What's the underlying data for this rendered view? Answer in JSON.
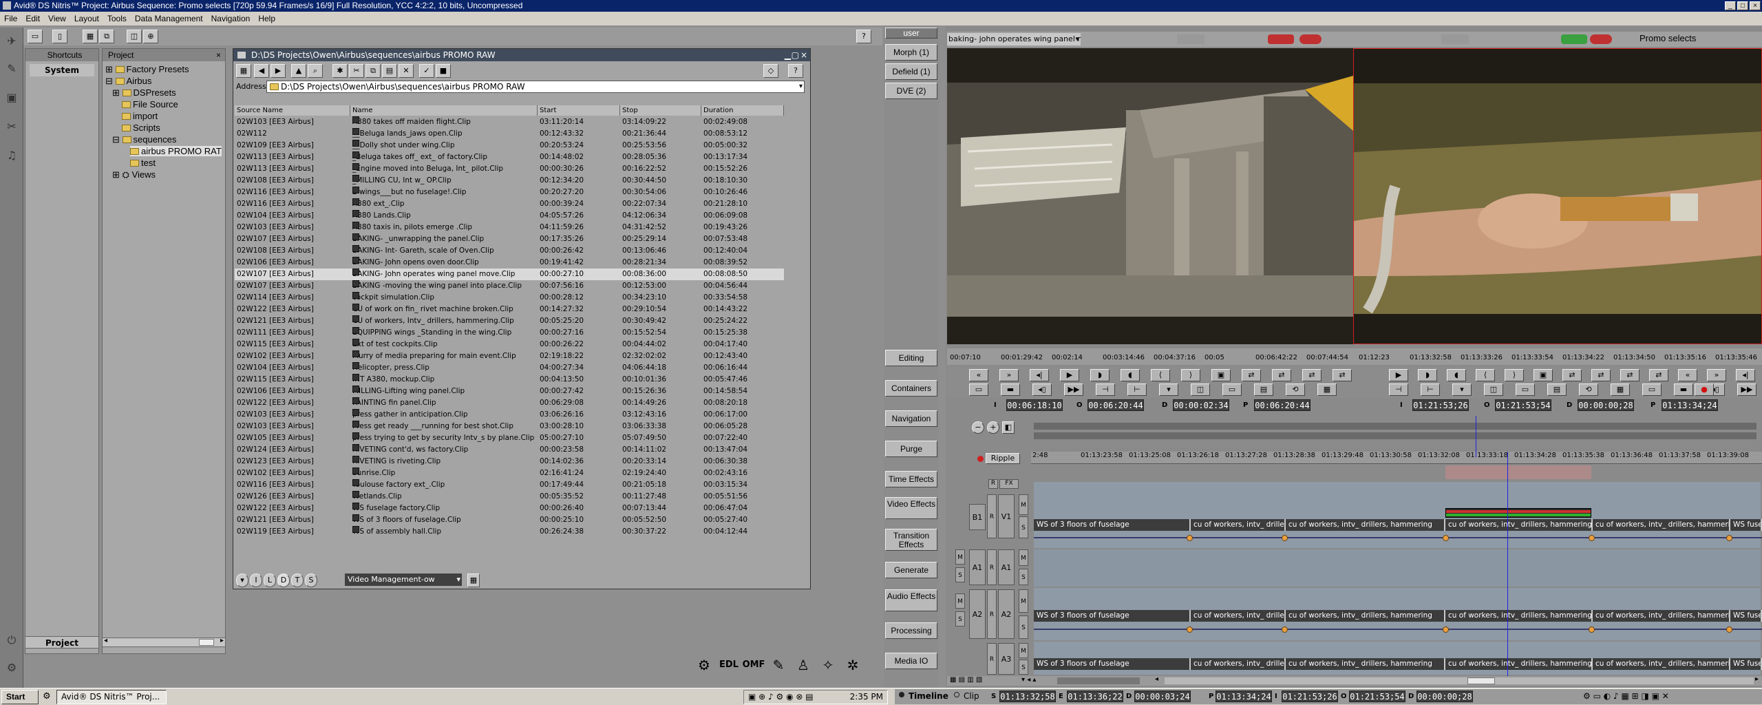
{
  "window": {
    "title": "Avid® DS Nitris™ Project: Airbus    Sequence: Promo selects    [720p 59.94 Frames/s 16/9]    Full Resolution, YCC 4:2:2, 10 bits, Uncompressed"
  },
  "menu": [
    "File",
    "Edit",
    "View",
    "Layout",
    "Tools",
    "Data Management",
    "Navigation",
    "Help"
  ],
  "shortcuts": {
    "tab": "Shortcuts",
    "system": "System"
  },
  "project": {
    "tab": "Project",
    "bottom_tab": "Project",
    "tree": [
      {
        "label": "Factory Presets",
        "level": 0
      },
      {
        "label": "Airbus",
        "level": 0
      },
      {
        "label": "DSPresets",
        "level": 1
      },
      {
        "label": "File Source",
        "level": 1
      },
      {
        "label": "import",
        "level": 1
      },
      {
        "label": "Scripts",
        "level": 1
      },
      {
        "label": "sequences",
        "level": 1
      },
      {
        "label": "airbus PROMO RAT",
        "level": 2
      },
      {
        "label": "test",
        "level": 2
      },
      {
        "label": "Views",
        "level": 1
      }
    ]
  },
  "bin": {
    "title": "D:\\DS Projects\\Owen\\Airbus\\sequences\\airbus PROMO RAW",
    "address_label": "Address",
    "address": "D:\\DS Projects\\Owen\\Airbus\\sequences\\airbus PROMO RAW",
    "columns": [
      "Source Name",
      "Name",
      "Start",
      "Stop",
      "Duration"
    ],
    "rows": [
      [
        "02W103 [EE3 Airbus]",
        "A380 takes off maiden flight.Clip",
        "03:11:20:14",
        "03:14:09:22",
        "00:02:49:08"
      ],
      [
        "02W112",
        "__Beluga lands_jaws open.Clip",
        "00:12:43:32",
        "00:21:36:44",
        "00:08:53:12"
      ],
      [
        "02W109 [EE3 Airbus]",
        "__Dolly shot under wing.Clip",
        "00:20:53:24",
        "00:25:53:56",
        "00:05:00:32"
      ],
      [
        "02W113 [EE3 Airbus]",
        "_Beluga takes off_ ext_ of factory.Clip",
        "00:14:48:02",
        "00:28:05:36",
        "00:13:17:34"
      ],
      [
        "02W113 [EE3 Airbus]",
        "_Engine moved into Beluga, Int_ pilot.Clip",
        "00:00:30:26",
        "00:16:22:52",
        "00:15:52:26"
      ],
      [
        "02W108 [EE3 Airbus]",
        "_MILLING CU, Int w_ OP.Clip",
        "00:12:34:20",
        "00:30:44:50",
        "00:18:10:30"
      ],
      [
        "02W116 [EE3 Airbus]",
        "2 wings___but no fuselage!.Clip",
        "00:20:27:20",
        "00:30:54:06",
        "00:10:26:46"
      ],
      [
        "02W116 [EE3 Airbus]",
        "A380 ext_.Clip",
        "00:00:39:24",
        "00:22:07:34",
        "00:21:28:10"
      ],
      [
        "02W104 [EE3 Airbus]",
        "A380 Lands.Clip",
        "04:05:57:26",
        "04:12:06:34",
        "00:06:09:08"
      ],
      [
        "02W103 [EE3 Airbus]",
        "A380 taxis in, pilots emerge  .Clip",
        "04:11:59:26",
        "04:31:42:52",
        "00:19:43:26"
      ],
      [
        "02W107 [EE3 Airbus]",
        "BAKING- _unwrapping the panel.Clip",
        "00:17:35:26",
        "00:25:29:14",
        "00:07:53:48"
      ],
      [
        "02W108 [EE3 Airbus]",
        "BAKING- Int- Gareth, scale of Oven.Clip",
        "00:00:26:42",
        "00:13:06:46",
        "00:12:40:04"
      ],
      [
        "02W106 [EE3 Airbus]",
        "BAKING- John opens oven door.Clip",
        "00:19:41:42",
        "00:28:21:34",
        "00:08:39:52"
      ],
      [
        "02W107 [EE3 Airbus]",
        "BAKING- John operates wing panel move.Clip",
        "00:00:27:10",
        "00:08:36:00",
        "00:08:08:50"
      ],
      [
        "02W107 [EE3 Airbus]",
        "BAKING -moving the wing panel into place.Clip",
        "00:07:56:16",
        "00:12:53:00",
        "00:04:56:44"
      ],
      [
        "02W114 [EE3 Airbus]",
        "cockpit simulation.Clip",
        "00:00:28:12",
        "00:34:23:10",
        "00:33:54:58"
      ],
      [
        "02W122 [EE3 Airbus]",
        "CU of work on fin_ rivet machine broken.Clip",
        "00:14:27:32",
        "00:29:10:54",
        "00:14:43:22"
      ],
      [
        "02W121 [EE3 Airbus]",
        "CU of workers, Intv_ drillers, hammering.Clip",
        "00:05:25:20",
        "00:30:49:42",
        "00:25:24:22"
      ],
      [
        "02W111 [EE3 Airbus]",
        "EQUIPPING wings _Standing in the wing.Clip",
        "00:00:27:16",
        "00:15:52:54",
        "00:15:25:38"
      ],
      [
        "02W115 [EE3 Airbus]",
        "Ext of test cockpits.Clip",
        "00:00:26:22",
        "00:04:44:02",
        "00:04:17:40"
      ],
      [
        "02W102 [EE3 Airbus]",
        "Flurry of media preparing for main event.Clip",
        "02:19:18:22",
        "02:32:02:02",
        "00:12:43:40"
      ],
      [
        "02W104 [EE3 Airbus]",
        "Helicopter, press.Clip",
        "04:00:27:34",
        "04:06:44:18",
        "00:06:16:44"
      ],
      [
        "02W115 [EE3 Airbus]",
        "INT A380, mockup.Clip",
        "00:04:13:50",
        "00:10:01:36",
        "00:05:47:46"
      ],
      [
        "02W106 [EE3 Airbus]",
        "MILLING-Lifting wing panel.Clip",
        "00:00:27:42",
        "00:15:26:36",
        "00:14:58:54"
      ],
      [
        "02W122 [EE3 Airbus]",
        "PAINTING fin panel.Clip",
        "00:06:29:08",
        "00:14:49:26",
        "00:08:20:18"
      ],
      [
        "02W103 [EE3 Airbus]",
        "press gather in anticipation.Clip",
        "03:06:26:16",
        "03:12:43:16",
        "00:06:17:00"
      ],
      [
        "02W103 [EE3 Airbus]",
        "Press get ready ___running for best shot.Clip",
        "03:00:28:10",
        "03:06:33:38",
        "00:06:05:28"
      ],
      [
        "02W105 [EE3 Airbus]",
        "press trying to get by security  Intv_s by plane.Clip",
        "05:00:27:10",
        "05:07:49:50",
        "00:07:22:40"
      ],
      [
        "02W124 [EE3 Airbus]",
        "RIVETING cont'd, ws factory.Clip",
        "00:00:23:58",
        "00:14:11:02",
        "00:13:47:04"
      ],
      [
        "02W123 [EE3 Airbus]",
        "RIVETING is riveting.Clip",
        "00:14:02:36",
        "00:20:33:14",
        "00:06:30:38"
      ],
      [
        "02W102 [EE3 Airbus]",
        "Sunrise.Clip",
        "02:16:41:24",
        "02:19:24:40",
        "00:02:43:16"
      ],
      [
        "02W116 [EE3 Airbus]",
        "Toulouse factory ext_.Clip",
        "00:17:49:44",
        "00:21:05:18",
        "00:03:15:34"
      ],
      [
        "02W126 [EE3 Airbus]",
        "Wetlands.Clip",
        "00:05:35:52",
        "00:11:27:48",
        "00:05:51:56"
      ],
      [
        "02W122 [EE3 Airbus]",
        "WS fuselage factory.Clip",
        "00:00:26:40",
        "00:07:13:44",
        "00:06:47:04"
      ],
      [
        "02W121 [EE3 Airbus]",
        "WS of 3 floors of fuselage.Clip",
        "00:00:25:10",
        "00:05:52:50",
        "00:05:27:40"
      ],
      [
        "02W119 [EE3 Airbus]",
        "WS of assembly hall.Clip",
        "00:26:24:38",
        "00:30:37:22",
        "00:04:12:44"
      ]
    ],
    "selected_row": 13,
    "footer_tabs": [
      "I",
      "L",
      "D",
      "T",
      "S"
    ],
    "view_select": "Video Management-ow"
  },
  "side_buttons": {
    "user": "user",
    "effects": [
      "Morph (1)",
      "Defield (1)",
      "DVE (2)"
    ],
    "tools": [
      "Editing",
      "Containers",
      "Navigation",
      "Purge",
      "Time Effects",
      "Video Effects",
      "Transition Effects",
      "Generate",
      "Audio Effects",
      "Processing",
      "Media IO"
    ]
  },
  "source_viewer": {
    "clip_name": "baking- john operates wing panel mov",
    "ruler": [
      "00:07:10",
      "00:01:29:42",
      "00:02:14",
      "00:03:14:46",
      "00:04:37:16",
      "00:05",
      "00:06:42:22",
      "00:07:44:54"
    ],
    "tc": {
      "I": "00:06:18:10",
      "O": "00:06:20:44",
      "D": "00:00:02:34",
      "P": "00:06:20:44"
    }
  },
  "record_viewer": {
    "name": "Promo selects",
    "ruler": [
      "01:12:23",
      "01:13:32:58",
      "01:13:33:26",
      "01:13:33:54",
      "01:13:34:22",
      "01:13:34:50",
      "01:13:35:16",
      "01:13:35:46"
    ],
    "tc": {
      "I": "01:21:53;26",
      "O": "01:21:53;54",
      "D": "00:00:00;28",
      "P": "01:13:34;24"
    }
  },
  "timeline": {
    "ripple": "Ripple",
    "ruler": [
      "2:48",
      "01:13:23:58",
      "01:13:25:08",
      "01:13:26:18",
      "01:13:27:28",
      "01:13:28:38",
      "01:13:29:48",
      "01:13:30:58",
      "01:13:32:08",
      "01:13:33:18",
      "01:13:34:28",
      "01:13:35:38",
      "01:13:36:48",
      "01:13:37:58",
      "01:13:39:08"
    ],
    "tracks": [
      "V1",
      "A1",
      "A2",
      "A3"
    ],
    "track_header": [
      "R",
      "FX"
    ],
    "segments": [
      "WS of 3 floors of fuselage",
      "cu of workers, intv_ driller",
      "cu of workers, intv_ drillers, hammering",
      "cu of workers, intv_ drillers, hammering",
      "cu of workers, intv_ drillers, hammering",
      "WS fuse"
    ],
    "bottom_tabs": [
      "Timeline",
      "Clip"
    ],
    "bottom_tc": {
      "S": "01:13:32;58",
      "E": "01:13:36;22",
      "D": "00:00:03;24",
      "P": "01:13:34;24",
      "I": "01:21:53;26",
      "O": "01:21:53;54",
      "D2": "00:00:00;28"
    }
  },
  "taskbar": {
    "start": "Start",
    "task": "Avid® DS Nitris™ Proj...",
    "clock": "2:35 PM"
  },
  "footer_icons": [
    "EDL",
    "OMF"
  ]
}
